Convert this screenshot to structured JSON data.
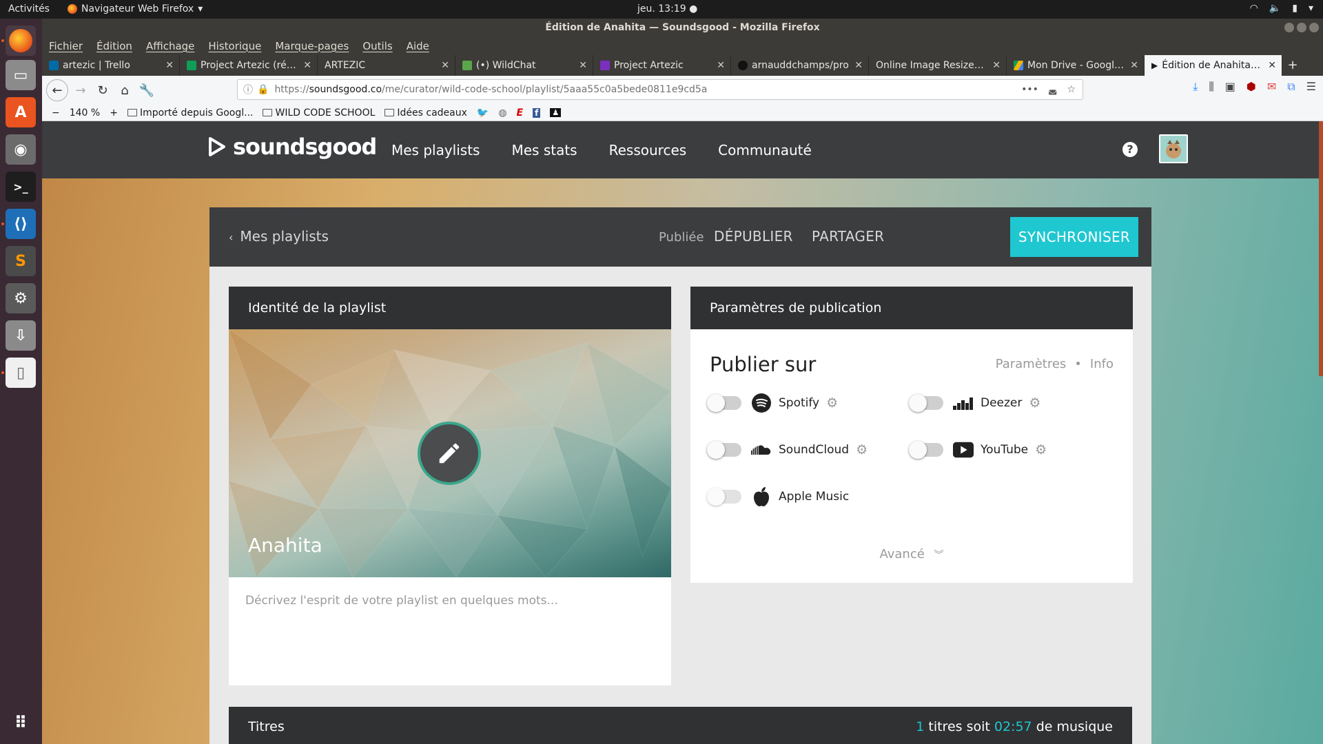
{
  "os": {
    "activities": "Activités",
    "app_menu": "Navigateur Web Firefox",
    "clock": "jeu. 13:19"
  },
  "window": {
    "title": "Édition de Anahita — Soundsgood - Mozilla Firefox"
  },
  "menubar": [
    "Fichier",
    "Édition",
    "Affichage",
    "Historique",
    "Marque-pages",
    "Outils",
    "Aide"
  ],
  "tabs": [
    {
      "label": "artezic | Trello",
      "color": "#026aa7"
    },
    {
      "label": "Project Artezic (répo",
      "color": "#0f9d58"
    },
    {
      "label": "ARTEZIC",
      "color": "#3c3b37"
    },
    {
      "label": "(•) WildChat",
      "color": "#5ba54b"
    },
    {
      "label": "Project Artezic",
      "color": "#7b2fbe"
    },
    {
      "label": "arnauddchamps/pro",
      "color": "#1a1a1a"
    },
    {
      "label": "Online Image Resizer - C",
      "color": "#3c3b37"
    },
    {
      "label": "Mon Drive - Google D",
      "color": "#f4b400"
    },
    {
      "label": "Édition de Anahita —",
      "color": "#1a1a1a",
      "active": true
    }
  ],
  "navbar": {
    "url_prefix": "https://",
    "url_host": "soundsgood.co",
    "url_path": "/me/curator/wild-code-school/playlist/5aaa55c0a5bede0811e9cd5a",
    "zoom": "140 %"
  },
  "bookmarks": [
    "Importé depuis Googl...",
    "WILD CODE SCHOOL",
    "Idées cadeaux"
  ],
  "site": {
    "logo": "soundsgood",
    "nav": [
      "Mes playlists",
      "Mes stats",
      "Ressources",
      "Communauté"
    ],
    "help": "?"
  },
  "toolbar": {
    "back": "Mes playlists",
    "status": "Publiée",
    "unpublish": "DÉPUBLIER",
    "share": "PARTAGER",
    "sync": "SYNCHRONISER"
  },
  "identity": {
    "header": "Identité de la playlist",
    "playlist_name": "Anahita",
    "description_placeholder": "Décrivez l'esprit de votre playlist en quelques mots..."
  },
  "publication": {
    "header": "Paramètres de publication",
    "title": "Publier sur",
    "settings_link": "Paramètres",
    "separator": "•",
    "info_link": "Info",
    "services": [
      {
        "name": "Spotify",
        "enabled": false,
        "has_settings": true
      },
      {
        "name": "Deezer",
        "enabled": false,
        "has_settings": true
      },
      {
        "name": "SoundCloud",
        "enabled": false,
        "has_settings": true
      },
      {
        "name": "YouTube",
        "enabled": false,
        "has_settings": true
      },
      {
        "name": "Apple Music",
        "enabled": false,
        "has_settings": false
      }
    ],
    "advanced": "Avancé"
  },
  "tracks": {
    "header": "Titres",
    "count": "1",
    "count_suffix": "titres soit",
    "duration": "02:57",
    "duration_suffix": "de musique"
  },
  "colors": {
    "accent": "#1fc7d1",
    "header_bg": "#3b3d3f",
    "card_header_bg": "#2f3133"
  }
}
